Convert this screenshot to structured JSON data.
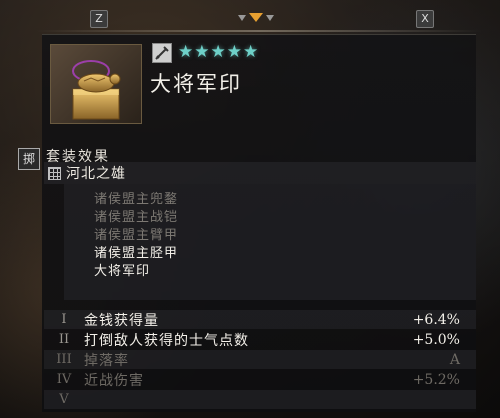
{
  "hints": {
    "left_key": "Z",
    "right_key": "X"
  },
  "colors": {
    "star": "#6ed0c8",
    "accent_arrow": "#e8a030",
    "active_text": "#f2efe8",
    "inactive_text": "#7c7872"
  },
  "item": {
    "icon": "golden-turtle-seal-icon",
    "rarity_icon": "sword-rarity-icon",
    "stars": [
      "★",
      "★",
      "★",
      "★",
      "★"
    ],
    "name": "大将军印"
  },
  "set_bonus": {
    "header": "套装效果",
    "side_badge": "掷",
    "title": "河北之雄",
    "pieces": [
      {
        "name": "诸侯盟主兜鍪",
        "owned": false
      },
      {
        "name": "诸侯盟主战铠",
        "owned": false
      },
      {
        "name": "诸侯盟主臂甲",
        "owned": false
      },
      {
        "name": "诸侯盟主胫甲",
        "owned": true
      },
      {
        "name": "大将军印",
        "owned": true
      }
    ]
  },
  "stats": [
    {
      "roman": "I",
      "name": "金钱获得量",
      "value": "+6.4%",
      "active": true
    },
    {
      "roman": "II",
      "name": "打倒敌人获得的士气点数",
      "value": "+5.0%",
      "active": true
    },
    {
      "roman": "III",
      "name": "掉落率",
      "value": "A",
      "active": false
    },
    {
      "roman": "IV",
      "name": "近战伤害",
      "value": "+5.2%",
      "active": false
    },
    {
      "roman": "V",
      "name": "",
      "value": "",
      "active": false
    }
  ]
}
